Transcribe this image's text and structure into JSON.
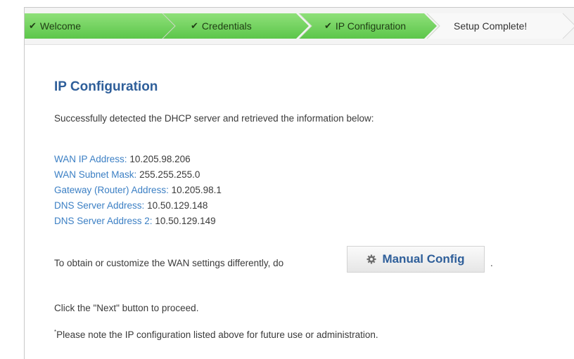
{
  "wizard": {
    "steps": [
      {
        "label": "Welcome",
        "done": true
      },
      {
        "label": "Credentials",
        "done": true
      },
      {
        "label": "IP Configuration",
        "done": true
      },
      {
        "label": "Setup Complete!",
        "done": false
      }
    ],
    "check_glyph": "✔"
  },
  "page": {
    "title": "IP Configuration",
    "intro": "Successfully detected the DHCP server and retrieved the information below:",
    "fields": [
      {
        "label": "WAN IP Address:",
        "value": "10.205.98.206"
      },
      {
        "label": "WAN Subnet Mask:",
        "value": "255.255.255.0"
      },
      {
        "label": "Gateway (Router) Address:",
        "value": "10.205.98.1"
      },
      {
        "label": "DNS Server Address:",
        "value": "10.50.129.148"
      },
      {
        "label": "DNS Server Address 2:",
        "value": "10.50.129.149"
      }
    ],
    "customize_text": "To obtain or customize the WAN settings differently, do",
    "manual_config_label": "Manual Config",
    "manual_config_icon": "gear-icon",
    "trailing_period": ".",
    "proceed_text": "Click the \"Next\" button to proceed.",
    "note_marker": "*",
    "note_text": "Please note the IP configuration listed above for future use or administration."
  },
  "colors": {
    "step_done": "#5cc64a",
    "title": "#2f5f9a",
    "label": "#3b7fc4"
  }
}
